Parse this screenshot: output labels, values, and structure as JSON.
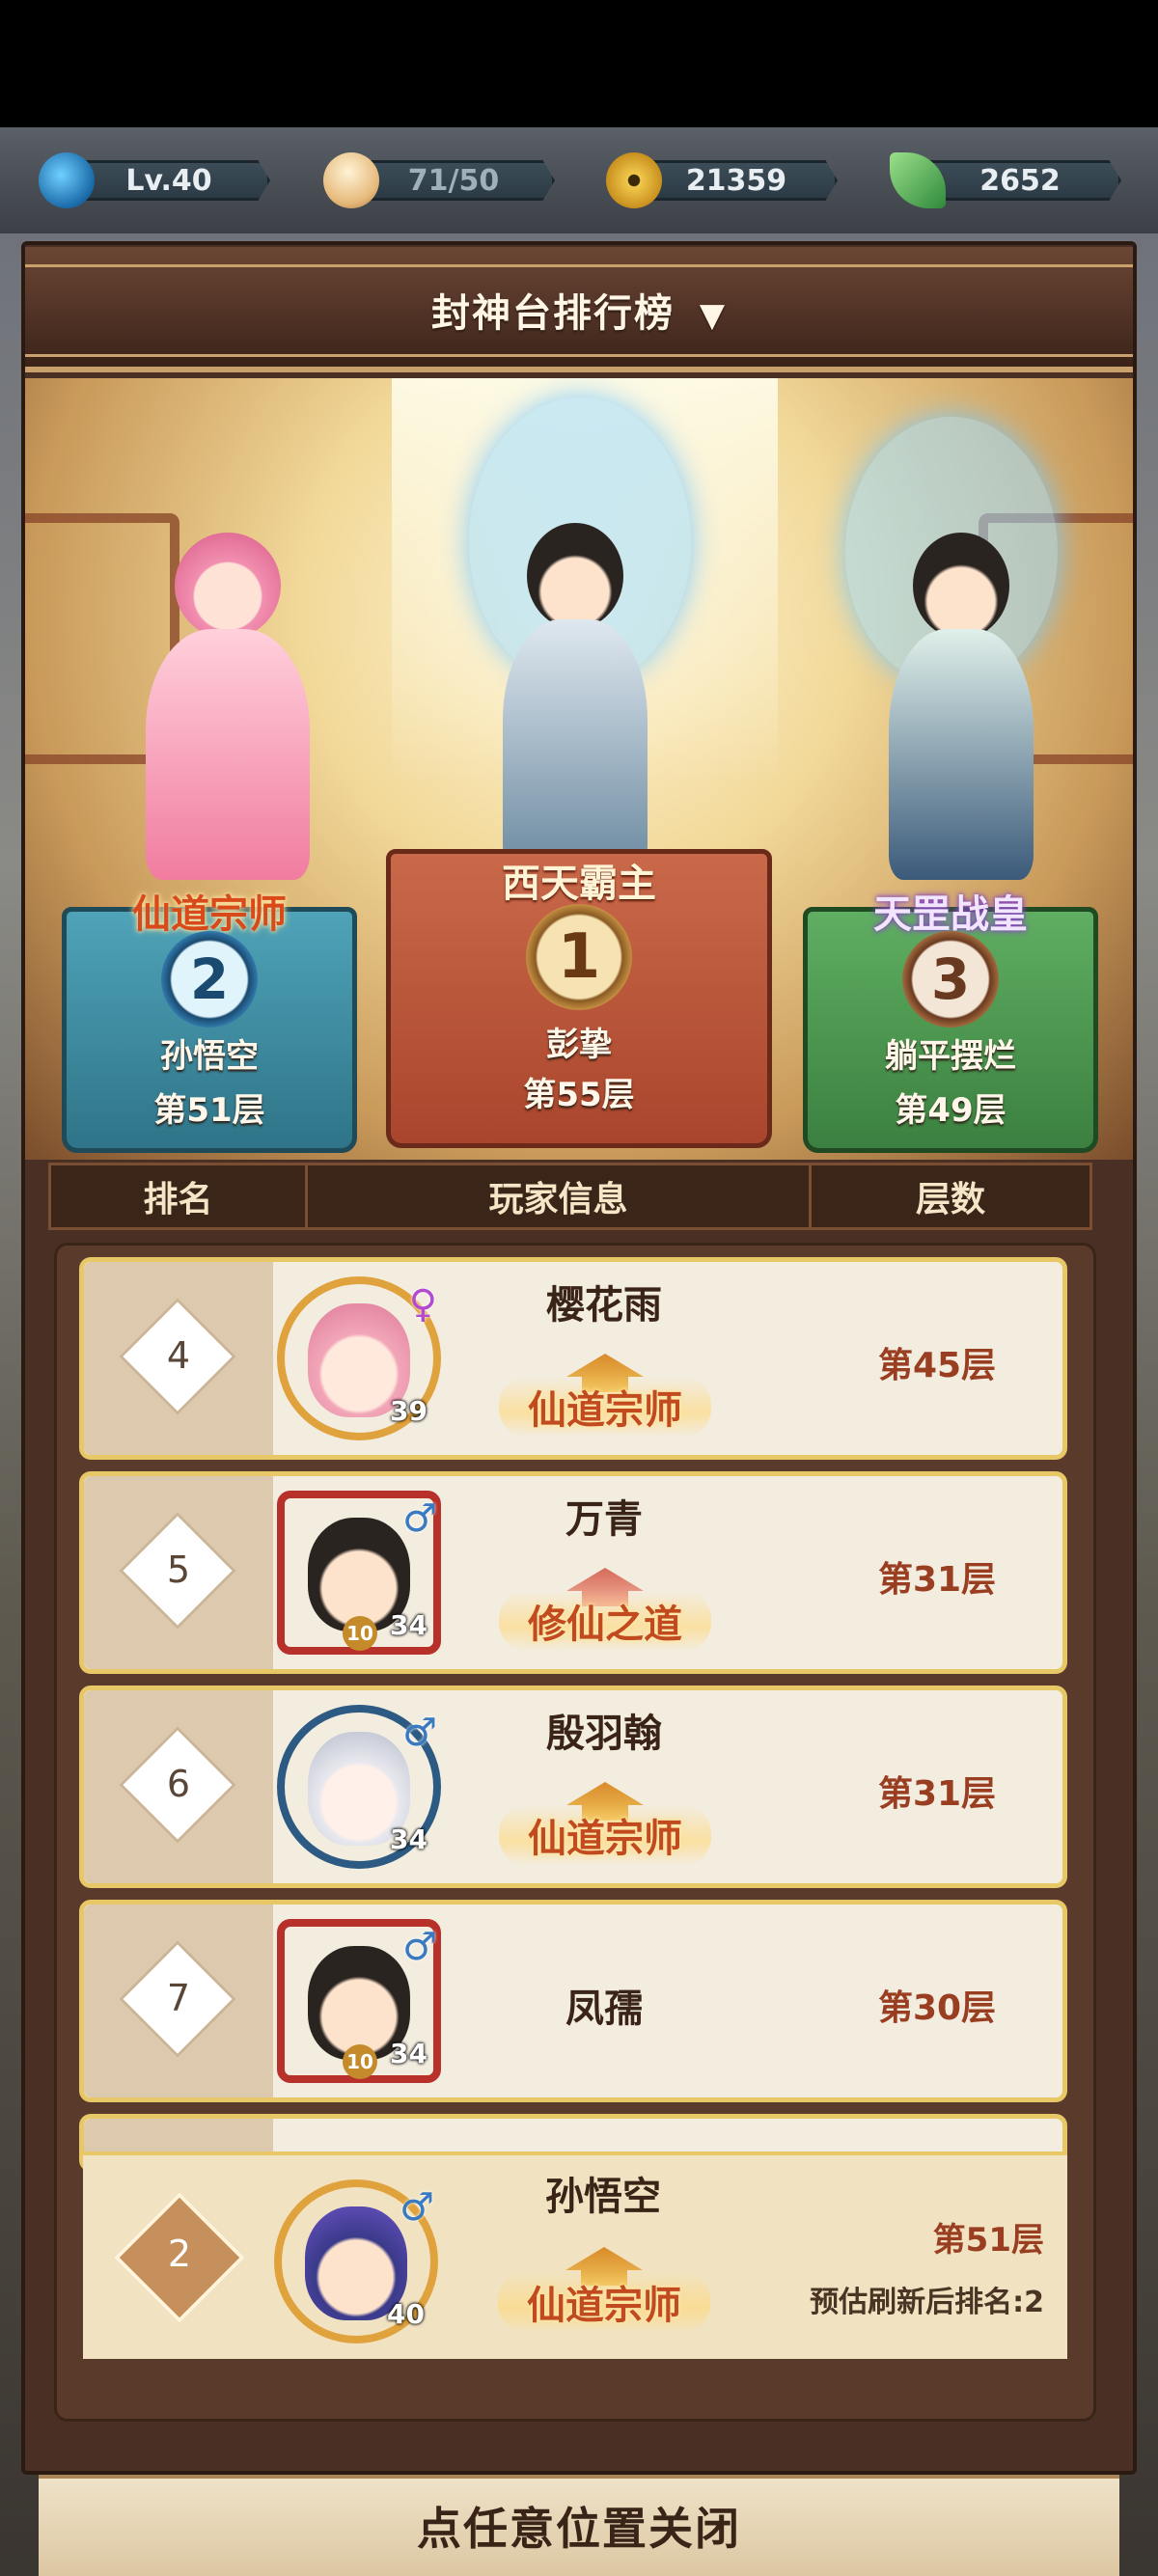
{
  "resources": {
    "level": "Lv.40",
    "stamina": "71/50",
    "coins": "21359",
    "jade": "2652"
  },
  "panel": {
    "title": "封神台排行榜",
    "dropdown_glyph": "▼"
  },
  "podium": [
    {
      "rank": "1",
      "title": "西天霸主",
      "name": "彭挚",
      "floor": "第55层",
      "color": "#b9553a"
    },
    {
      "rank": "2",
      "title": "仙道宗师",
      "name": "孙悟空",
      "floor": "第51层",
      "color": "#3f8aa0"
    },
    {
      "rank": "3",
      "title": "天罡战皇",
      "name": "躺平摆烂",
      "floor": "第49层",
      "color": "#4f9a58"
    }
  ],
  "table": {
    "col_rank": "排名",
    "col_info": "玩家信息",
    "col_floor": "层数"
  },
  "rows": [
    {
      "rank": "4",
      "name": "樱花雨",
      "gender": "♀",
      "level": "39",
      "title": "仙道宗师",
      "floor": "第45层"
    },
    {
      "rank": "5",
      "name": "万青",
      "gender": "♂",
      "level": "34",
      "title": "修仙之道",
      "floor": "第31层",
      "sub_badge": "10"
    },
    {
      "rank": "6",
      "name": "殷羽翰",
      "gender": "♂",
      "level": "34",
      "title": "仙道宗师",
      "floor": "第31层"
    },
    {
      "rank": "7",
      "name": "凤孺",
      "gender": "♂",
      "level": "34",
      "title": "",
      "floor": "第30层",
      "sub_badge": "10"
    }
  ],
  "my_rank": {
    "rank": "2",
    "name": "孙悟空",
    "gender": "♂",
    "level": "40",
    "title": "仙道宗师",
    "floor": "第51层",
    "estimate": "预估刷新后排名:2"
  },
  "close_hint": "点任意位置关闭"
}
